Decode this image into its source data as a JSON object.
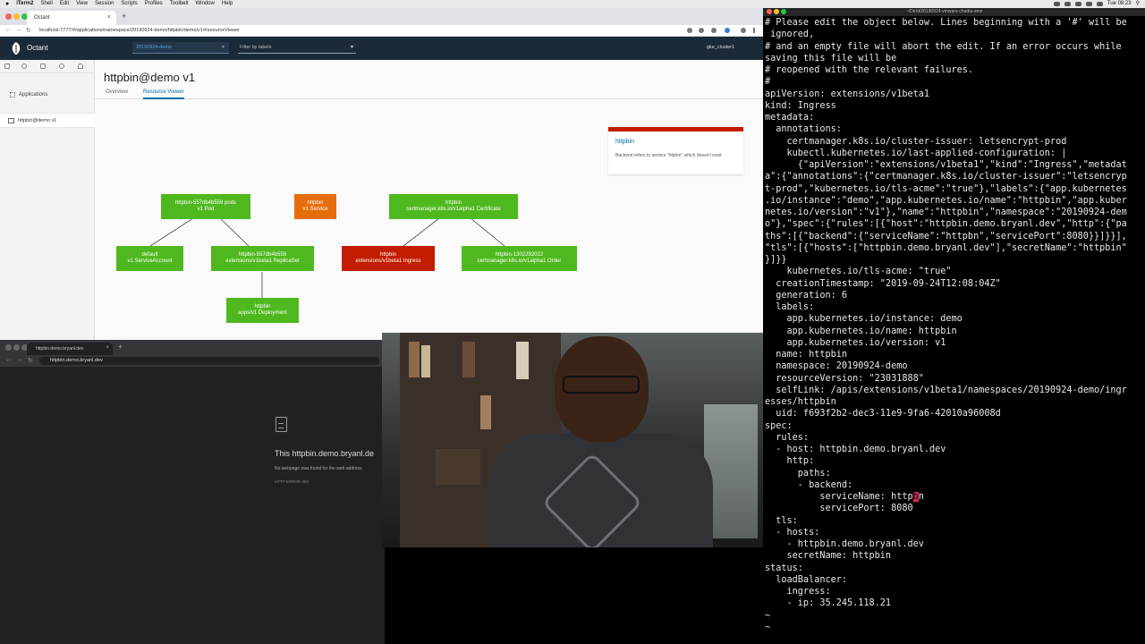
{
  "menubar": {
    "apple": "",
    "items": [
      "iTerm2",
      "Shell",
      "Edit",
      "View",
      "Session",
      "Scripts",
      "Profiles",
      "Toolbelt",
      "Window",
      "Help"
    ],
    "clock": "Tue 08:23"
  },
  "browser_top": {
    "tab_title": "Octant",
    "url": "localhost:7777/#/applications/namespace/20190924-demo/httpbin/demo/v1#resourceViewer"
  },
  "octant": {
    "app_name": "Octant",
    "namespace": "20190924-demo",
    "filter_placeholder": "Filter by labels",
    "cluster": "gke_cluster1",
    "sidebar": {
      "applications_label": "Applications",
      "item_label": "httpbin@demo v1"
    },
    "page_title": "httpbin@demo v1",
    "tabs": [
      "Overview",
      "Resource Viewer"
    ],
    "graph_nodes": [
      {
        "line1": "httpbin-557db4b559 pods",
        "line2": "v1 Pod",
        "status": "ok"
      },
      {
        "line1": "httpbin",
        "line2": "v1 Service",
        "status": "warning"
      },
      {
        "line1": "httpbin",
        "line2": "certmanager.k8s.io/v1alpha1 Certificate",
        "status": "ok"
      },
      {
        "line1": "default",
        "line2": "v1 ServiceAccount",
        "status": "ok"
      },
      {
        "line1": "httpbin-557db4b559",
        "line2": "extensions/v1beta1 ReplicaSet",
        "status": "ok"
      },
      {
        "line1": "httpbin",
        "line2": "extensions/v1beta1 Ingress",
        "status": "error"
      },
      {
        "line1": "httpbin-1302292022",
        "line2": "certmanager.k8s.io/v1alpha1 Order",
        "status": "ok"
      },
      {
        "line1": "httpbin",
        "line2": "apps/v1 Deployment",
        "status": "ok"
      }
    ],
    "detail_card": {
      "title": "httpbin",
      "description": "Backend refers to service \"httpbn\" which doesn't exist"
    }
  },
  "browser_bottom": {
    "tab_title": "httpbin.demo.bryanl.dev",
    "url": "httpbin.demo.bryanl.dev",
    "error_title": "This httpbin.demo.bryanl.de",
    "error_sub": "No webpage was found for the web address",
    "error_code": "HTTP ERROR 404"
  },
  "terminal": {
    "title": "~/Dir/d/20190924-vmware-chatbu-sme",
    "lines": [
      "# Please edit the object below. Lines beginning with a '#' will be",
      " ignored,",
      "# and an empty file will abort the edit. If an error occurs while",
      "saving this file will be",
      "# reopened with the relevant failures.",
      "#",
      "apiVersion: extensions/v1beta1",
      "kind: Ingress",
      "metadata:",
      "  annotations:",
      "    certmanager.k8s.io/cluster-issuer: letsencrypt-prod",
      "    kubectl.kubernetes.io/last-applied-configuration: |",
      "      {\"apiVersion\":\"extensions/v1beta1\",\"kind\":\"Ingress\",\"metadat",
      "a\":{\"annotations\":{\"certmanager.k8s.io/cluster-issuer\":\"letsencryp",
      "t-prod\",\"kubernetes.io/tls-acme\":\"true\"},\"labels\":{\"app.kubernetes",
      ".io/instance\":\"demo\",\"app.kubernetes.io/name\":\"httpbin\",\"app.kuber",
      "netes.io/version\":\"v1\"},\"name\":\"httpbin\",\"namespace\":\"20190924-dem",
      "o\"},\"spec\":{\"rules\":[{\"host\":\"httpbin.demo.bryanl.dev\",\"http\":{\"pa",
      "ths\":[{\"backend\":{\"serviceName\":\"httpbn\",\"servicePort\":8080}}]}}],",
      "\"tls\":[{\"hosts\":[\"httpbin.demo.bryanl.dev\"],\"secretName\":\"httpbin\"",
      "}]}}",
      "    kubernetes.io/tls-acme: \"true\"",
      "  creationTimestamp: \"2019-09-24T12:08:04Z\"",
      "  generation: 6",
      "  labels:",
      "    app.kubernetes.io/instance: demo",
      "    app.kubernetes.io/name: httpbin",
      "    app.kubernetes.io/version: v1",
      "  name: httpbin",
      "  namespace: 20190924-demo",
      "  resourceVersion: \"23031888\"",
      "  selfLink: /apis/extensions/v1beta1/namespaces/20190924-demo/ingr",
      "esses/httpbin",
      "  uid: f693f2b2-dec3-11e9-9fa6-42010a96008d",
      "spec:",
      "  rules:",
      "  - host: httpbin.demo.bryanl.dev",
      "    http:",
      "      paths:",
      "      - backend:",
      "          serviceName: httpbn",
      "          servicePort: 8080",
      "  tls:",
      "  - hosts:",
      "    - httpbin.demo.bryanl.dev",
      "    secretName: httpbin",
      "status:",
      "  loadBalancer:",
      "    ingress:",
      "    - ip: 35.245.118.21",
      "~",
      "~"
    ]
  },
  "colors": {
    "ok": "#4fb81f",
    "warning": "#e56d0c",
    "error": "#c21d00",
    "octant_header": "#1b2a39",
    "link": "#0072a3"
  }
}
